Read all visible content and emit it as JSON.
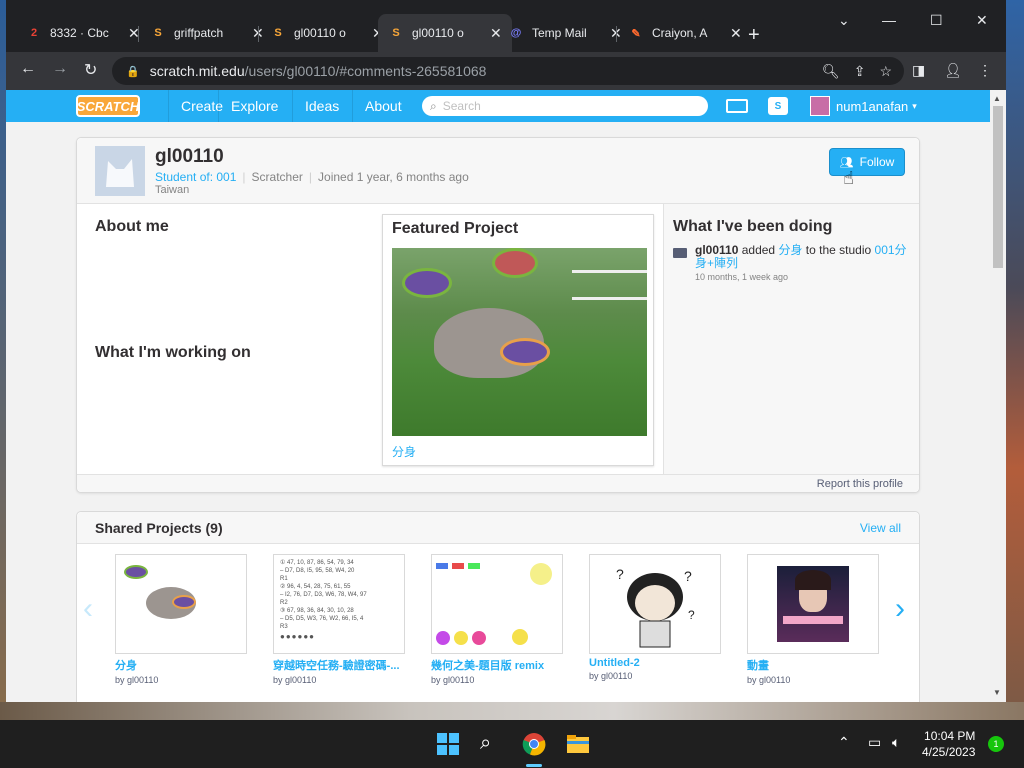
{
  "browser": {
    "tabs": [
      {
        "label": "8332 · Cbc",
        "favicon": "2",
        "favicon_color": "#e94235"
      },
      {
        "label": "griffpatch",
        "favicon": "S",
        "favicon_color": "#f9a739"
      },
      {
        "label": "gl00110 o",
        "favicon": "S",
        "favicon_color": "#f9a739"
      },
      {
        "label": "gl00110 o",
        "favicon": "S",
        "favicon_color": "#f9a739"
      },
      {
        "label": "Temp Mail",
        "favicon": "@",
        "favicon_color": "#7b7fff"
      },
      {
        "label": "Craiyon, A",
        "favicon": "✎",
        "favicon_color": "#ff6a2f"
      }
    ],
    "url_host": "scratch.mit.edu",
    "url_path": "/users/gl00110/#comments-265581068"
  },
  "nav": {
    "logo": "SCRATCH",
    "links": [
      "Create",
      "Explore",
      "Ideas",
      "About"
    ],
    "search_placeholder": "Search",
    "username": "num1anafan"
  },
  "profile": {
    "username": "gl00110",
    "student_of": "Student of: 001",
    "role": "Scratcher",
    "joined": "Joined 1 year, 6 months ago",
    "country": "Taiwan",
    "follow_label": "Follow",
    "about_me": "About me",
    "working_on": "What I'm working on",
    "featured_title": "Featured Project",
    "featured_project": "分身",
    "doing_title": "What I've been doing",
    "activity": {
      "user": "gl00110",
      "verb": "added",
      "project": "分身",
      "mid": "to the studio",
      "studio": "001分身+陣列",
      "time": "10 months, 1 week ago"
    },
    "report": "Report this profile"
  },
  "shared": {
    "title": "Shared Projects (9)",
    "view_all": "View all",
    "projects": [
      {
        "title": "分身",
        "by": "by gl00110"
      },
      {
        "title": "穿越時空任務-驗證密碼-...",
        "by": "by gl00110"
      },
      {
        "title": "幾何之美-題目版 remix",
        "by": "by gl00110"
      },
      {
        "title": "Untitled-2",
        "by": "by gl00110"
      },
      {
        "title": "動畫",
        "by": "by gl00110"
      }
    ],
    "thumb2_lines": [
      "① 47, 10, 87, 86, 54, 79, 34",
      "– D7, D8, I5, 95, 58, W4, 20",
      "R1",
      "② 96, 4, 54, 28, 75, 61, 55",
      "– I2, 76, D7, D3, W6, 78, W4, 97",
      "R2",
      "③ 67, 98, 36, 84, 30, 10, 28",
      "– D5, D5, W3, 76, W2, 66, I5, 4",
      "R3"
    ]
  },
  "taskbar": {
    "time": "10:04 PM",
    "date": "4/25/2023",
    "notifications": "1"
  }
}
